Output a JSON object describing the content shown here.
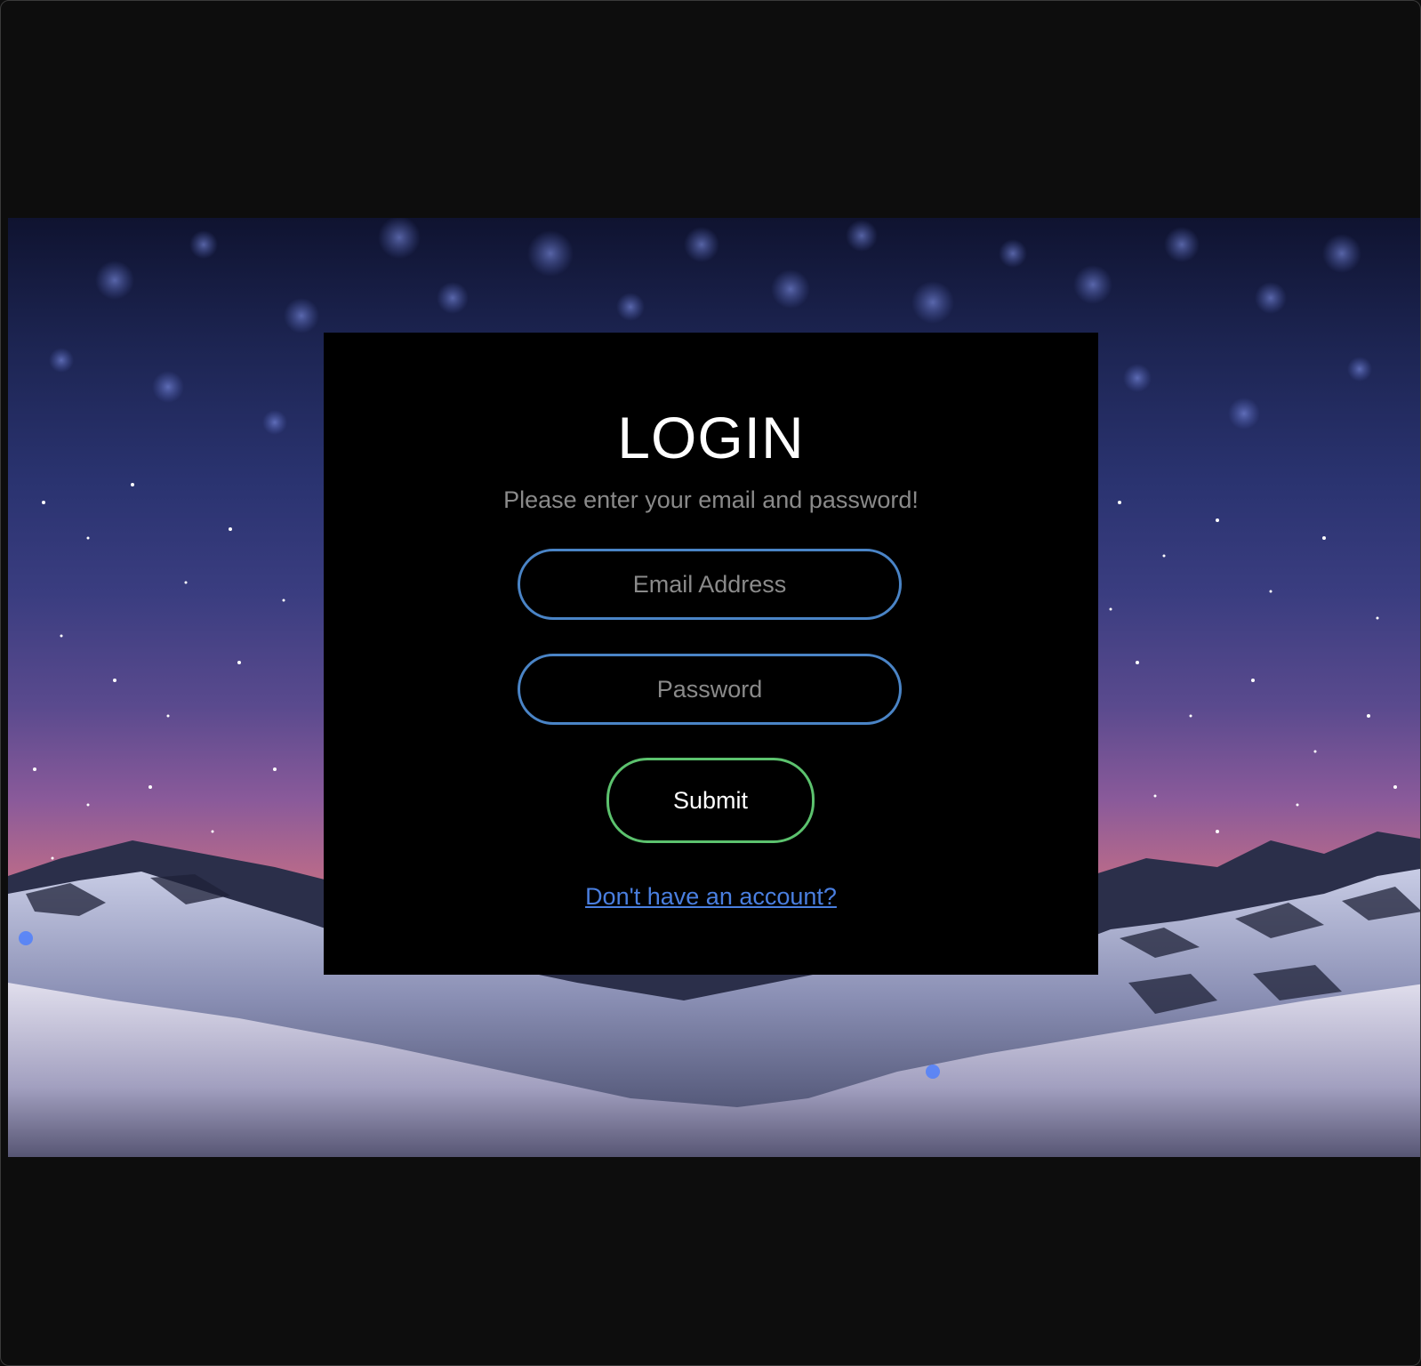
{
  "login": {
    "title": "LOGIN",
    "subtitle": "Please enter your email and password!",
    "email_placeholder": "Email Address",
    "password_placeholder": "Password",
    "submit_label": "Submit",
    "signup_link": "Don't have an account?"
  },
  "colors": {
    "page_background": "#0d0d0d",
    "card_background": "#000000",
    "input_border": "#4a84c6",
    "submit_border": "#5cc26e",
    "link": "#4a7fe0"
  },
  "background_image": {
    "description_icon": "starry-mountain-night-image"
  }
}
